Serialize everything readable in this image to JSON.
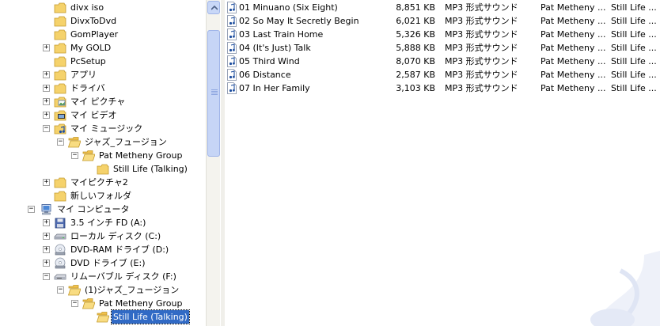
{
  "tree": {
    "items": [
      {
        "label": "divx iso",
        "indent": 1,
        "expander": "",
        "icon": "folder"
      },
      {
        "label": "DivxToDvd",
        "indent": 1,
        "expander": "",
        "icon": "folder"
      },
      {
        "label": "GomPlayer",
        "indent": 1,
        "expander": "",
        "icon": "folder"
      },
      {
        "label": "My GOLD",
        "indent": 1,
        "expander": "+",
        "icon": "folder"
      },
      {
        "label": "PcSetup",
        "indent": 1,
        "expander": "",
        "icon": "folder"
      },
      {
        "label": "アプリ",
        "indent": 1,
        "expander": "+",
        "icon": "folder"
      },
      {
        "label": "ドライバ",
        "indent": 1,
        "expander": "+",
        "icon": "folder"
      },
      {
        "label": "マイ ピクチャ",
        "indent": 1,
        "expander": "+",
        "icon": "pictures"
      },
      {
        "label": "マイ ビデオ",
        "indent": 1,
        "expander": "+",
        "icon": "video"
      },
      {
        "label": "マイ ミュージック",
        "indent": 1,
        "expander": "−",
        "icon": "music"
      },
      {
        "label": "ジャズ_フュージョン",
        "indent": 2,
        "expander": "−",
        "icon": "folder-open"
      },
      {
        "label": "Pat Metheny Group",
        "indent": 3,
        "expander": "−",
        "icon": "folder-open"
      },
      {
        "label": "Still Life (Talking)",
        "indent": 4,
        "expander": "",
        "icon": "folder"
      },
      {
        "label": "マイピクチャ2",
        "indent": 1,
        "expander": "+",
        "icon": "folder"
      },
      {
        "label": "新しいフォルダ",
        "indent": 1,
        "expander": "",
        "icon": "folder"
      },
      {
        "label": "マイ コンピュータ",
        "indent": 0,
        "expander": "−",
        "icon": "computer"
      },
      {
        "label": "3.5 インチ FD (A:)",
        "indent": 1,
        "expander": "+",
        "icon": "floppy"
      },
      {
        "label": "ローカル ディスク (C:)",
        "indent": 1,
        "expander": "+",
        "icon": "disk"
      },
      {
        "label": "DVD-RAM ドライブ (D:)",
        "indent": 1,
        "expander": "+",
        "icon": "dvd"
      },
      {
        "label": "DVD ドライブ (E:)",
        "indent": 1,
        "expander": "+",
        "icon": "dvd"
      },
      {
        "label": "リムーバブル ディスク (F:)",
        "indent": 1,
        "expander": "−",
        "icon": "removable"
      },
      {
        "label": "(1)ジャズ_フュージョン",
        "indent": 2,
        "expander": "−",
        "icon": "folder-open"
      },
      {
        "label": "Pat Metheny Group",
        "indent": 3,
        "expander": "−",
        "icon": "folder-open"
      },
      {
        "label": "Still Life (Talking)",
        "indent": 4,
        "expander": "",
        "icon": "folder-open",
        "selected": true
      }
    ]
  },
  "files": [
    {
      "name": "01 Minuano (Six Eight)",
      "size": "8,851 KB",
      "type": "MP3 形式サウンド",
      "artist": "Pat Metheny ...",
      "album": "Still Life ..."
    },
    {
      "name": "02 So May It Secretly Begin",
      "size": "6,021 KB",
      "type": "MP3 形式サウンド",
      "artist": "Pat Metheny ...",
      "album": "Still Life ..."
    },
    {
      "name": "03 Last Train Home",
      "size": "5,326 KB",
      "type": "MP3 形式サウンド",
      "artist": "Pat Metheny ...",
      "album": "Still Life ..."
    },
    {
      "name": "04 (It's Just) Talk",
      "size": "5,888 KB",
      "type": "MP3 形式サウンド",
      "artist": "Pat Metheny ...",
      "album": "Still Life ..."
    },
    {
      "name": "05 Third Wind",
      "size": "8,070 KB",
      "type": "MP3 形式サウンド",
      "artist": "Pat Metheny ...",
      "album": "Still Life ..."
    },
    {
      "name": "06 Distance",
      "size": "2,587 KB",
      "type": "MP3 形式サウンド",
      "artist": "Pat Metheny ...",
      "album": "Still Life ..."
    },
    {
      "name": "07 In Her Family",
      "size": "3,103 KB",
      "type": "MP3 形式サウンド",
      "artist": "Pat Metheny ...",
      "album": "Still Life ..."
    }
  ],
  "colors": {
    "selection": "#316ac5",
    "folder": "#f5d26b",
    "scrollbar": "#c6d5f6"
  },
  "icons": {
    "scroll_up": "scroll-up-arrow-icon",
    "file": "audio-file-icon",
    "watermark": "music-note-icon"
  }
}
